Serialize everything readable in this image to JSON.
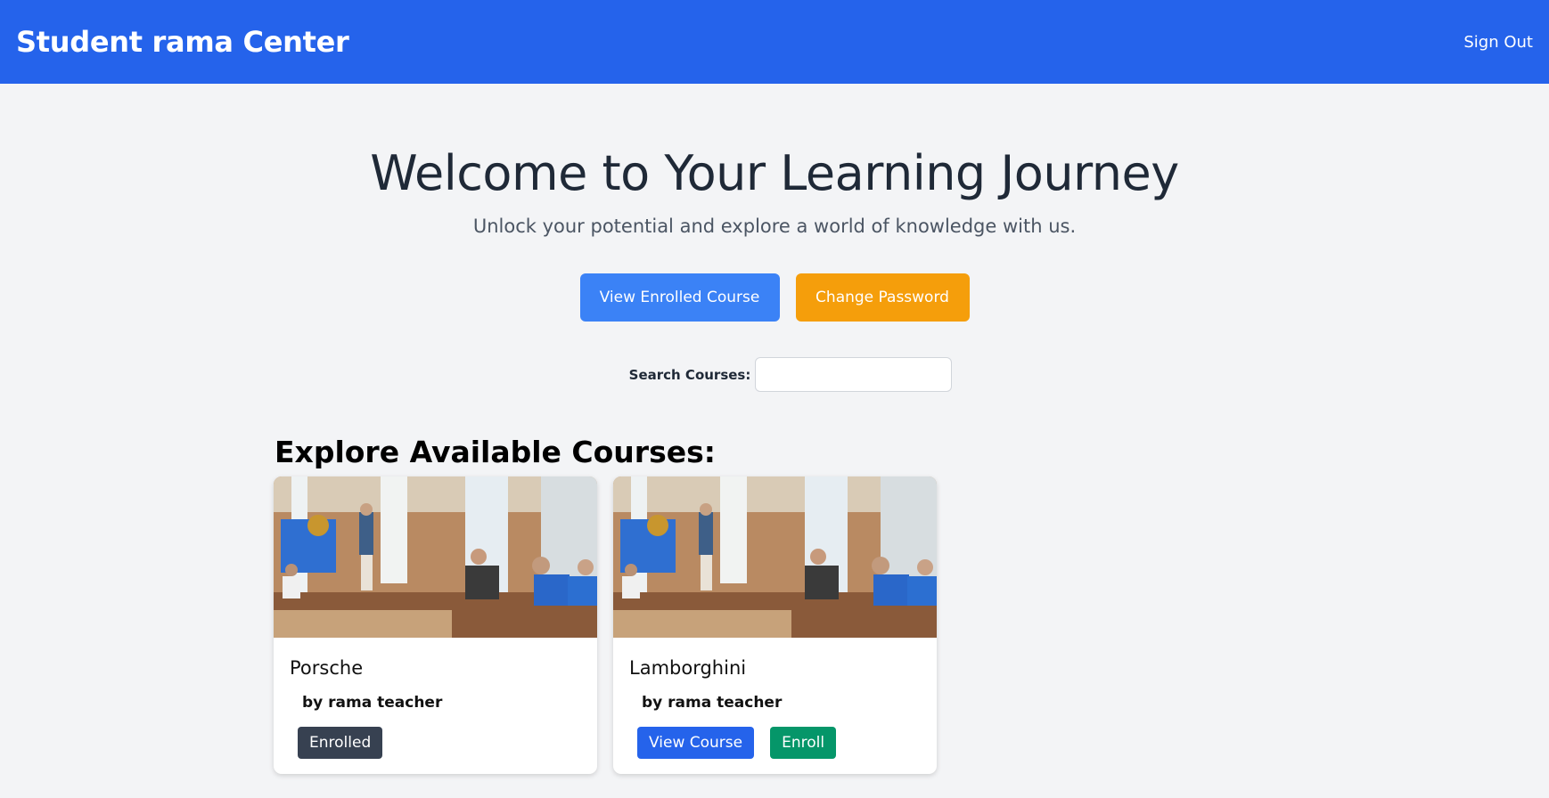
{
  "nav": {
    "brand": "Student rama Center",
    "signout": "Sign Out"
  },
  "hero": {
    "title": "Welcome to Your Learning Journey",
    "subtitle": "Unlock your potential and explore a world of knowledge with us.",
    "primary_button": "View Enrolled Course",
    "secondary_button": "Change Password"
  },
  "search": {
    "label": "Search Courses:",
    "value": "",
    "placeholder": ""
  },
  "courses_section": {
    "title": "Explore Available Courses:",
    "courses": [
      {
        "title": "Porsche",
        "teacher": "by rama teacher",
        "status_label": "Enrolled"
      },
      {
        "title": "Lamborghini",
        "teacher": "by rama teacher",
        "view_label": "View Course",
        "enroll_label": "Enroll"
      }
    ]
  },
  "colors": {
    "navbar": "#2563eb",
    "primary_button": "#3b82f6",
    "secondary_button": "#f59e0b",
    "enrolled_badge": "#374151",
    "view_button": "#2563eb",
    "enroll_button": "#059669"
  }
}
